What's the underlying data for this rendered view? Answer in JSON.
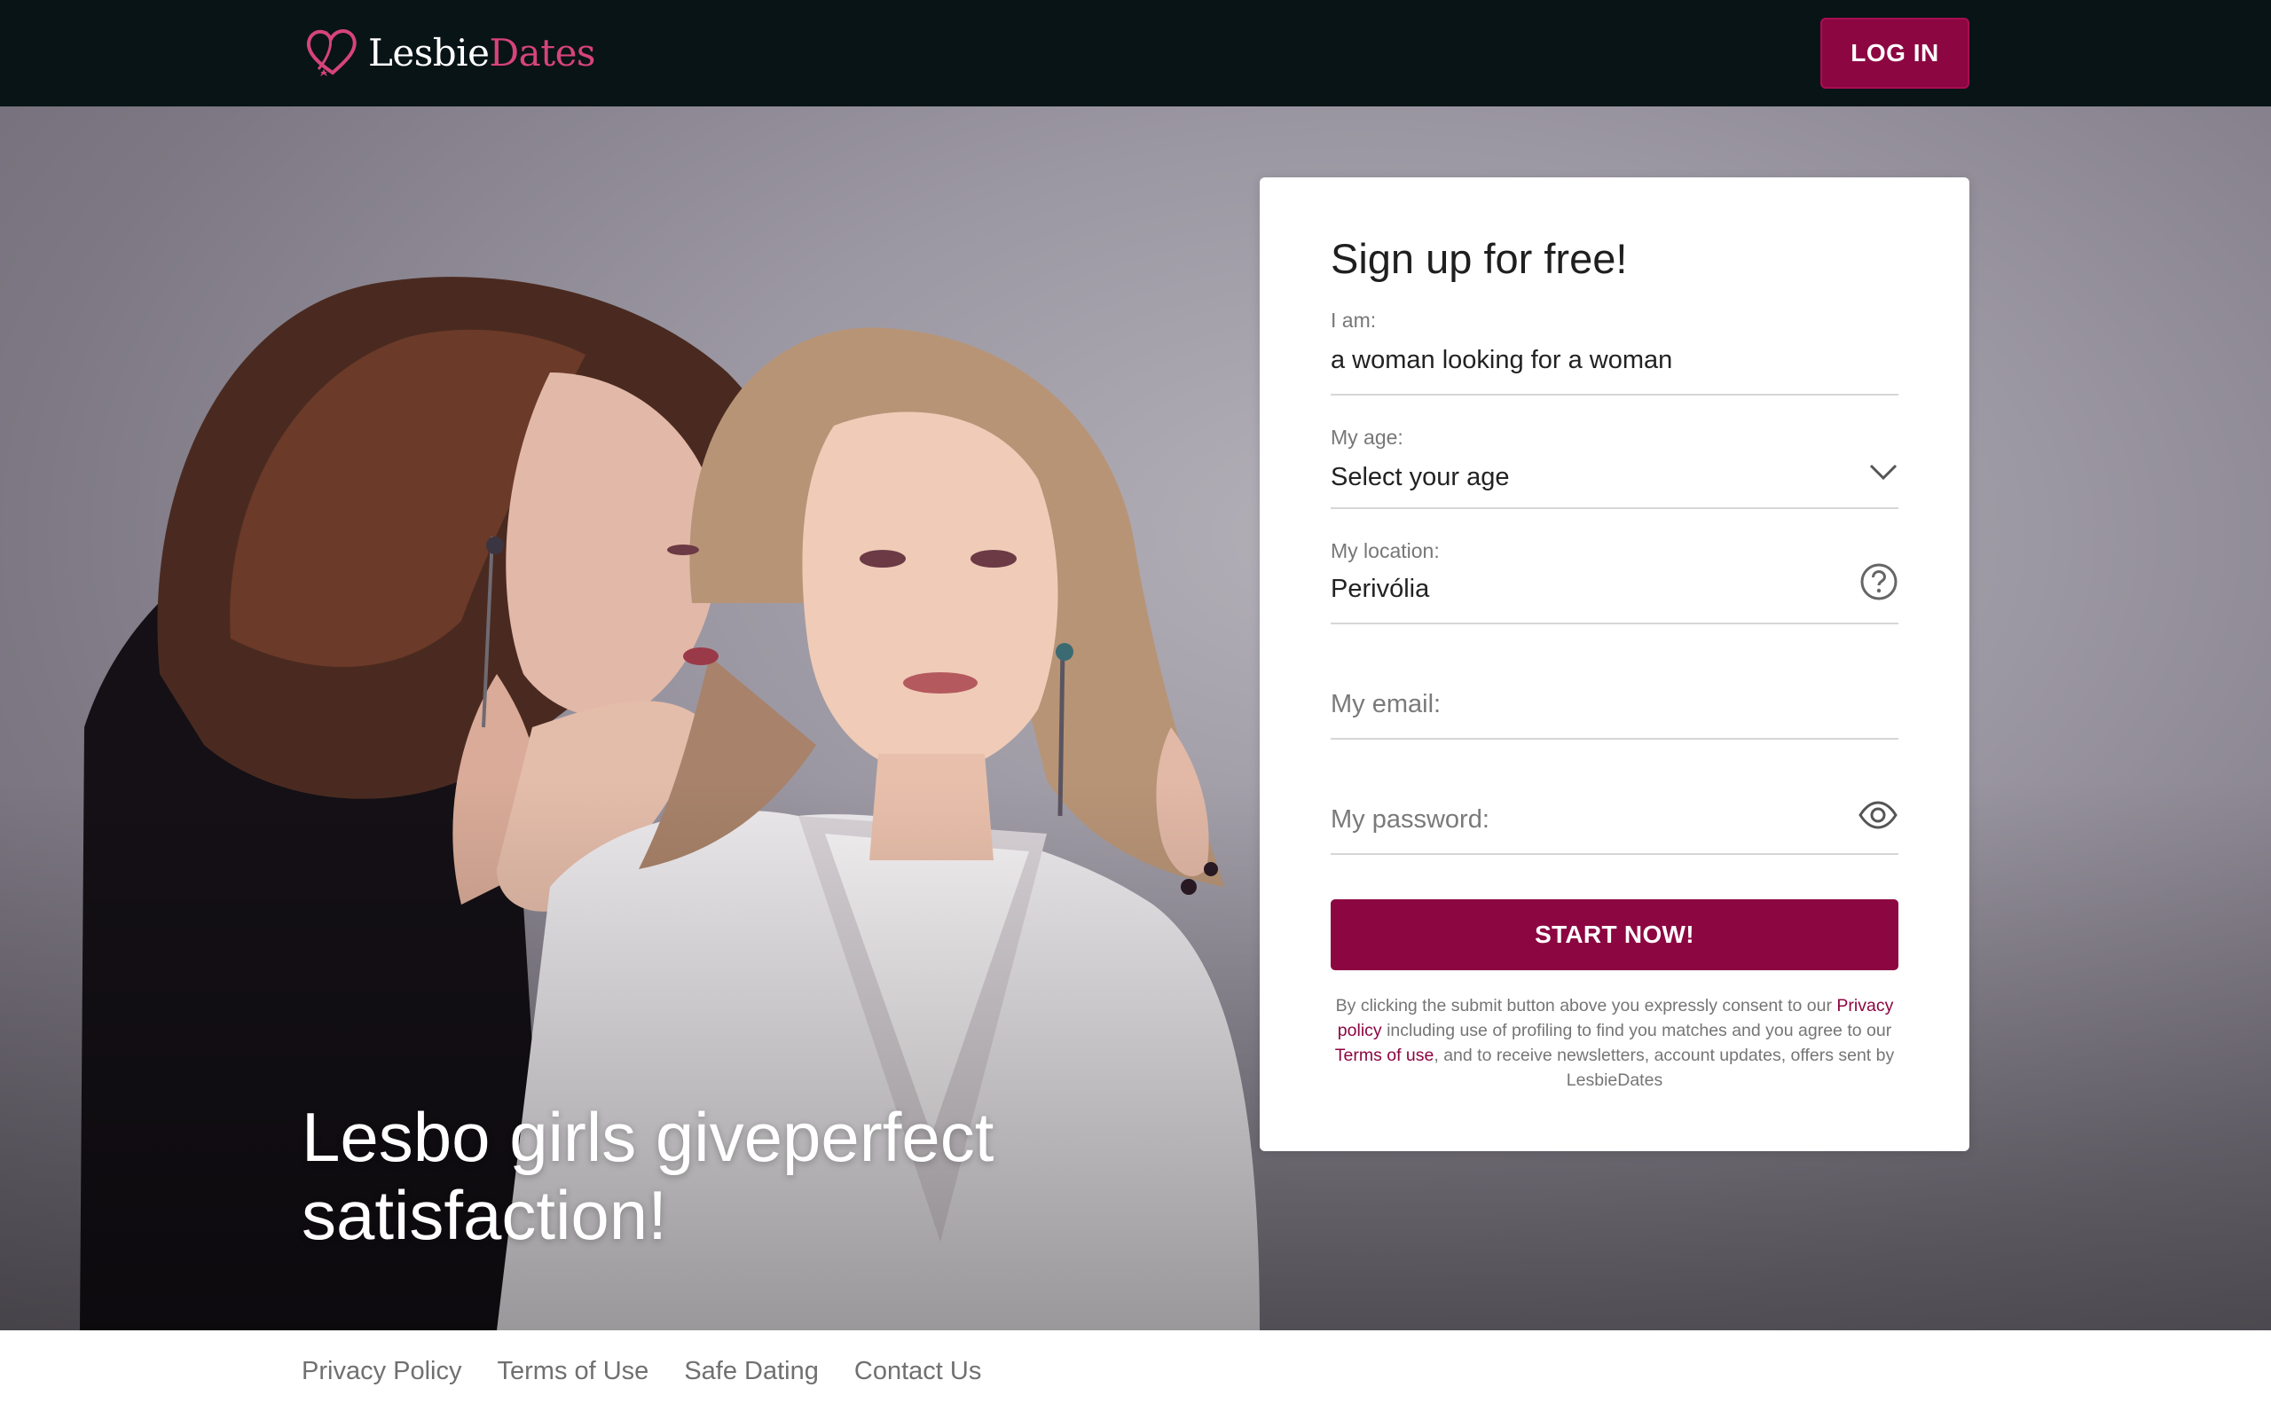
{
  "header": {
    "logo_word1": "Lesbie",
    "logo_word2": "Dates",
    "login_label": "LOG IN"
  },
  "hero": {
    "headline": "Lesbo girls giveperfect satisfaction!"
  },
  "signup": {
    "title": "Sign up for free!",
    "iam_label": "I am:",
    "iam_value": "a woman looking for a woman",
    "age_label": "My age:",
    "age_value": "Select your age",
    "location_label": "My location:",
    "location_value": "Perivólia",
    "email_placeholder": "My email:",
    "password_placeholder": "My password:",
    "submit_label": "START NOW!",
    "consent": {
      "part1": "By clicking the submit button above you expressly consent to our ",
      "privacy_link": "Privacy policy",
      "part2": " including use of profiling to find you matches and you agree to our ",
      "terms_link": "Terms of use",
      "part3": ", and to receive newsletters, account updates, offers sent by LesbieDates"
    },
    "icons": {
      "age": "chevron-down-icon",
      "location": "help-circle-icon",
      "password": "eye-icon"
    }
  },
  "footer": {
    "links": [
      "Privacy Policy",
      "Terms of Use",
      "Safe Dating",
      "Contact Us"
    ]
  },
  "colors": {
    "header_bg": "#091416",
    "brand": "#8c0641",
    "logo_pink": "#d6447a"
  }
}
